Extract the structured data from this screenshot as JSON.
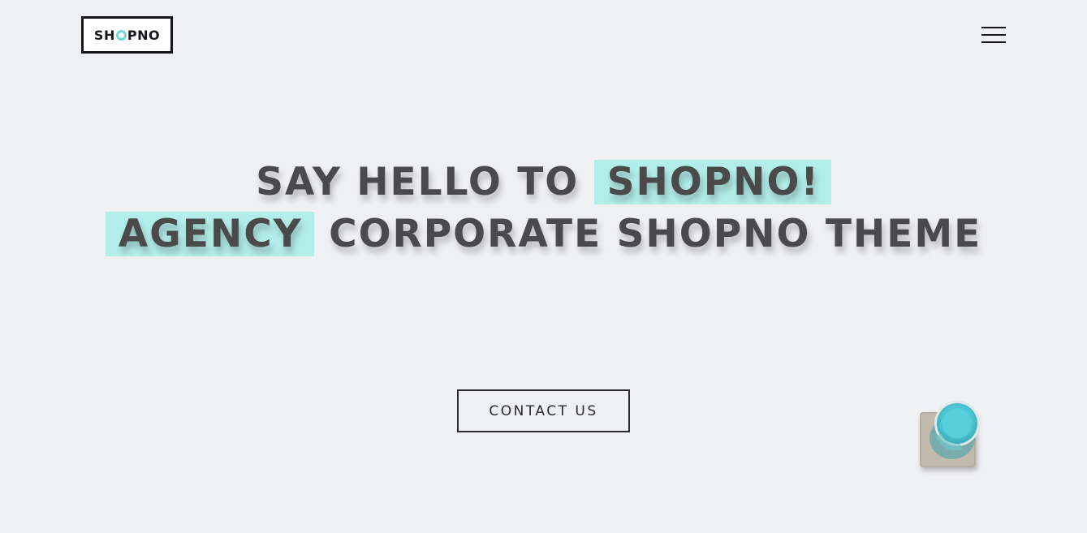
{
  "header": {
    "logo": {
      "before": "SH",
      "after": "PNO"
    },
    "menu_icon": "hamburger-icon"
  },
  "hero": {
    "line1": {
      "plain": "SAY HELLO TO",
      "highlight": "SHOPNO!"
    },
    "line2": {
      "highlight": "AGENCY",
      "plain": "CORPORATE SHOPNO THEME"
    },
    "cta_label": "CONTACT US"
  },
  "colors": {
    "background": "#eff0f2",
    "highlight": "#b3ede8",
    "text": "#4a4a4c",
    "accent": "#6fd8d6"
  },
  "decor": {
    "image": "coffee-cup-illustration"
  }
}
